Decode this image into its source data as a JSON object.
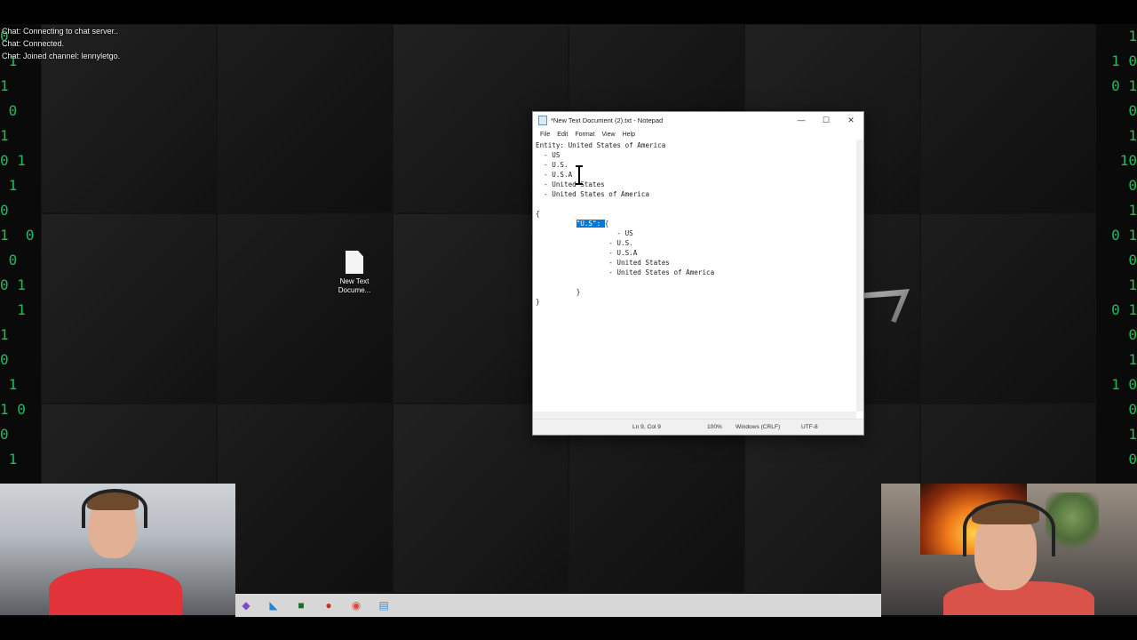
{
  "chat": {
    "lines": [
      "Chat: Connecting to chat server..",
      "Chat: Connected.",
      "Chat: Joined channel: lennyletgo."
    ]
  },
  "desktop": {
    "icons": [
      {
        "label": "New Text Docume...",
        "icon": "text-file-icon"
      }
    ]
  },
  "notepad": {
    "title": "*New Text Document (2).txt - Notepad",
    "menu": [
      "File",
      "Edit",
      "Format",
      "View",
      "Help"
    ],
    "content": {
      "lines": [
        "Entity: United States of America",
        "  - US",
        "  - U.S.",
        "  - U.S.A",
        "  - United States",
        "  - United States of America",
        "",
        "{",
        "          ",
        "                    - US",
        "                  - U.S.",
        "                  - U.S.A",
        "                  - United States",
        "                  - United States of America",
        "",
        "          }",
        "}"
      ],
      "line9_selected": "\"U.S\": ",
      "line9_after": "{"
    },
    "status": {
      "position": "Ln 9, Col 9",
      "zoom": "100%",
      "line_endings": "Windows (CRLF)",
      "encoding": "UTF-8"
    }
  },
  "taskbar": {
    "icons": [
      "visual-studio-icon",
      "vscode-icon",
      "terminal-icon",
      "obs-icon",
      "chrome-icon",
      "notepad-icon"
    ]
  },
  "colors": {
    "selection": "#0078d7",
    "matrix_green": "#1bd16a"
  }
}
